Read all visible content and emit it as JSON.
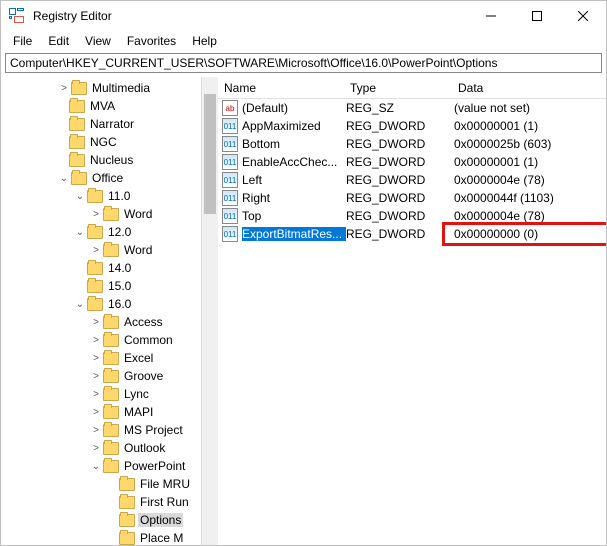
{
  "title": "Registry Editor",
  "menus": {
    "file": "File",
    "edit": "Edit",
    "view": "View",
    "favorites": "Favorites",
    "help": "Help"
  },
  "address": "Computer\\HKEY_CURRENT_USER\\SOFTWARE\\Microsoft\\Office\\16.0\\PowerPoint\\Options",
  "tree": {
    "n0": "Multimedia",
    "n1": "MVA",
    "n2": "Narrator",
    "n3": "NGC",
    "n4": "Nucleus",
    "n5": "Office",
    "n6": "11.0",
    "n7": "Word",
    "n8": "12.0",
    "n9": "Word",
    "n10": "14.0",
    "n11": "15.0",
    "n12": "16.0",
    "n13": "Access",
    "n14": "Common",
    "n15": "Excel",
    "n16": "Groove",
    "n17": "Lync",
    "n18": "MAPI",
    "n19": "MS Project",
    "n20": "Outlook",
    "n21": "PowerPoint",
    "n22": "File MRU",
    "n23": "First Run",
    "n24": "Options",
    "n25": "Place M"
  },
  "columns": {
    "name": "Name",
    "type": "Type",
    "data": "Data"
  },
  "rows": {
    "r0": {
      "name": "(Default)",
      "type": "REG_SZ",
      "data": "(value not set)"
    },
    "r1": {
      "name": "AppMaximized",
      "type": "REG_DWORD",
      "data": "0x00000001 (1)"
    },
    "r2": {
      "name": "Bottom",
      "type": "REG_DWORD",
      "data": "0x0000025b (603)"
    },
    "r3": {
      "name": "EnableAccChec...",
      "type": "REG_DWORD",
      "data": "0x00000001 (1)"
    },
    "r4": {
      "name": "Left",
      "type": "REG_DWORD",
      "data": "0x0000004e (78)"
    },
    "r5": {
      "name": "Right",
      "type": "REG_DWORD",
      "data": "0x0000044f (1103)"
    },
    "r6": {
      "name": "Top",
      "type": "REG_DWORD",
      "data": "0x0000004e (78)"
    },
    "r7": {
      "name": "ExportBitmatRes...",
      "type": "REG_DWORD",
      "data": "0x00000000 (0)"
    }
  }
}
